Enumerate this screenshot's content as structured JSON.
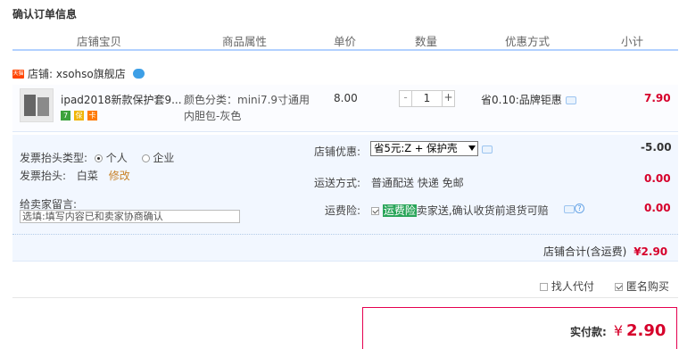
{
  "page_title": "确认订单信息",
  "columns": [
    "店铺宝贝",
    "商品属性",
    "单价",
    "数量",
    "优惠方式",
    "小计"
  ],
  "shop": {
    "tag_icon": "tmall-tag-icon",
    "label": "店铺: xsohso旗舰店",
    "chat_icon": "wangwang-icon"
  },
  "item": {
    "title": "ipad2018新款保护套9...",
    "badges": [
      "7",
      "保",
      "卡"
    ],
    "attr_line1": "颜色分类：mini7.9寸通用",
    "attr_line2": "内胆包-灰色",
    "unit_price": "8.00",
    "qty_minus": "-",
    "quantity": "1",
    "qty_plus": "+",
    "discount": "省0.10:品牌钜惠",
    "subtotal": "7.90"
  },
  "invoice": {
    "type_label": "发票抬头类型:",
    "opt_personal": "个人",
    "opt_company": "企业",
    "header_label": "发票抬头:",
    "header_value": "白菜",
    "modify_link": "修改"
  },
  "message": {
    "label": "给卖家留言:",
    "placeholder": "选填:填写内容已和卖家协商确认"
  },
  "shop_discount": {
    "label": "店铺优惠:",
    "selected": "省5元:Z + 保护壳",
    "amount": "-5.00"
  },
  "shipping": {
    "label": "运送方式:",
    "value": "普通配送 快递 免邮",
    "amount": "0.00"
  },
  "insurance": {
    "label": "运费险:",
    "highlight": "运费险",
    "text": "卖家送,确认收货前退货可赔",
    "amount": "0.00"
  },
  "shop_total": {
    "label": "店铺合计(含运费)",
    "amount": "¥2.90"
  },
  "options": {
    "proxy_pay": "找人代付",
    "anonymous": "匿名购买"
  },
  "payment": {
    "label": "实付款:",
    "currency": "¥",
    "amount": "2.90"
  },
  "colors": {
    "accent_red": "#d6002b",
    "header_line": "#b2d1ff",
    "option_bg": "#f2f7ff"
  }
}
